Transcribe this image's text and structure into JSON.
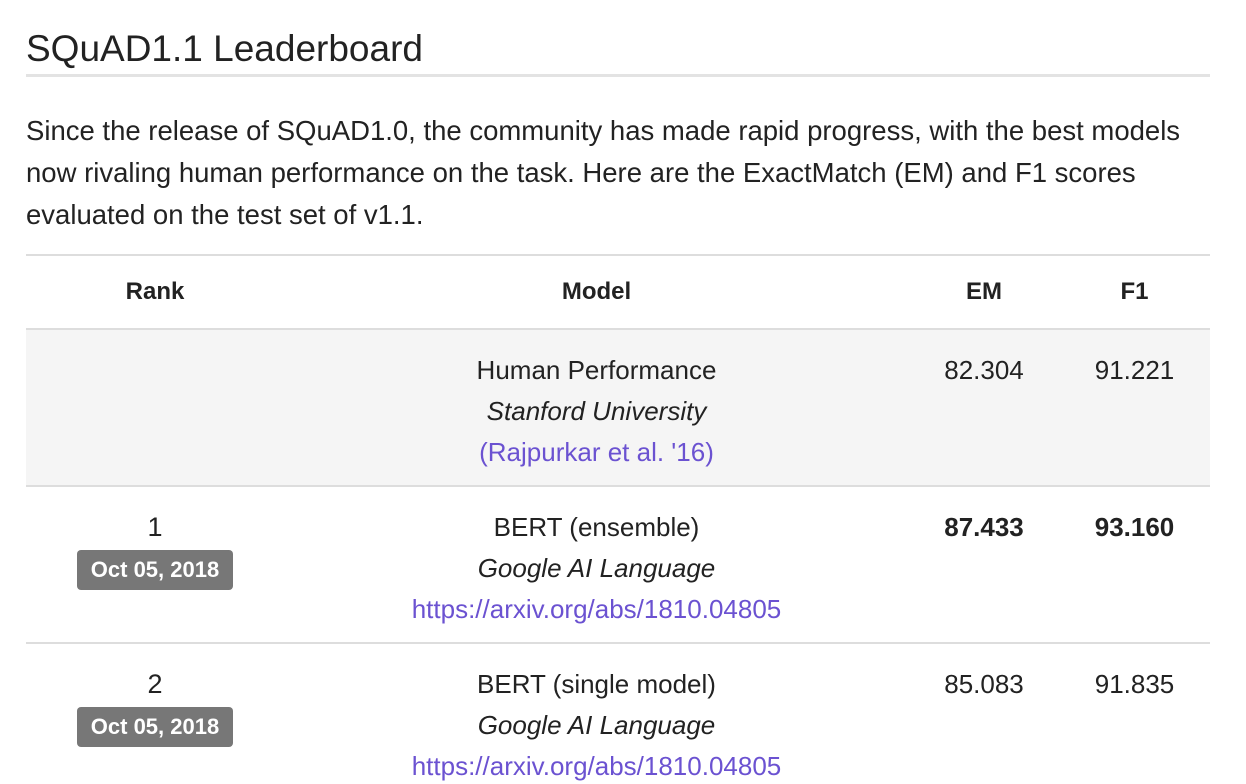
{
  "title": "SQuAD1.1 Leaderboard",
  "intro": "Since the release of SQuAD1.0, the community has made rapid progress, with the best models now rivaling human performance on the task. Here are the ExactMatch (EM) and F1 scores evaluated on the test set of v1.1.",
  "table": {
    "headers": {
      "rank": "Rank",
      "model": "Model",
      "em": "EM",
      "f1": "F1"
    },
    "human": {
      "model": "Human Performance",
      "org": "Stanford University",
      "link": "(Rajpurkar et al. '16)",
      "em": "82.304",
      "f1": "91.221"
    },
    "rows": [
      {
        "rank": "1",
        "date": "Oct 05, 2018",
        "model": "BERT (ensemble)",
        "org": "Google AI Language",
        "link": "https://arxiv.org/abs/1810.04805",
        "em": "87.433",
        "f1": "93.160",
        "best": true
      },
      {
        "rank": "2",
        "date": "Oct 05, 2018",
        "model": "BERT (single model)",
        "org": "Google AI Language",
        "link": "https://arxiv.org/abs/1810.04805",
        "em": "85.083",
        "f1": "91.835",
        "best": false
      }
    ]
  },
  "colors": {
    "link": "#6b52d1",
    "badge": "#777777",
    "human_row_bg": "#f5f5f5"
  }
}
